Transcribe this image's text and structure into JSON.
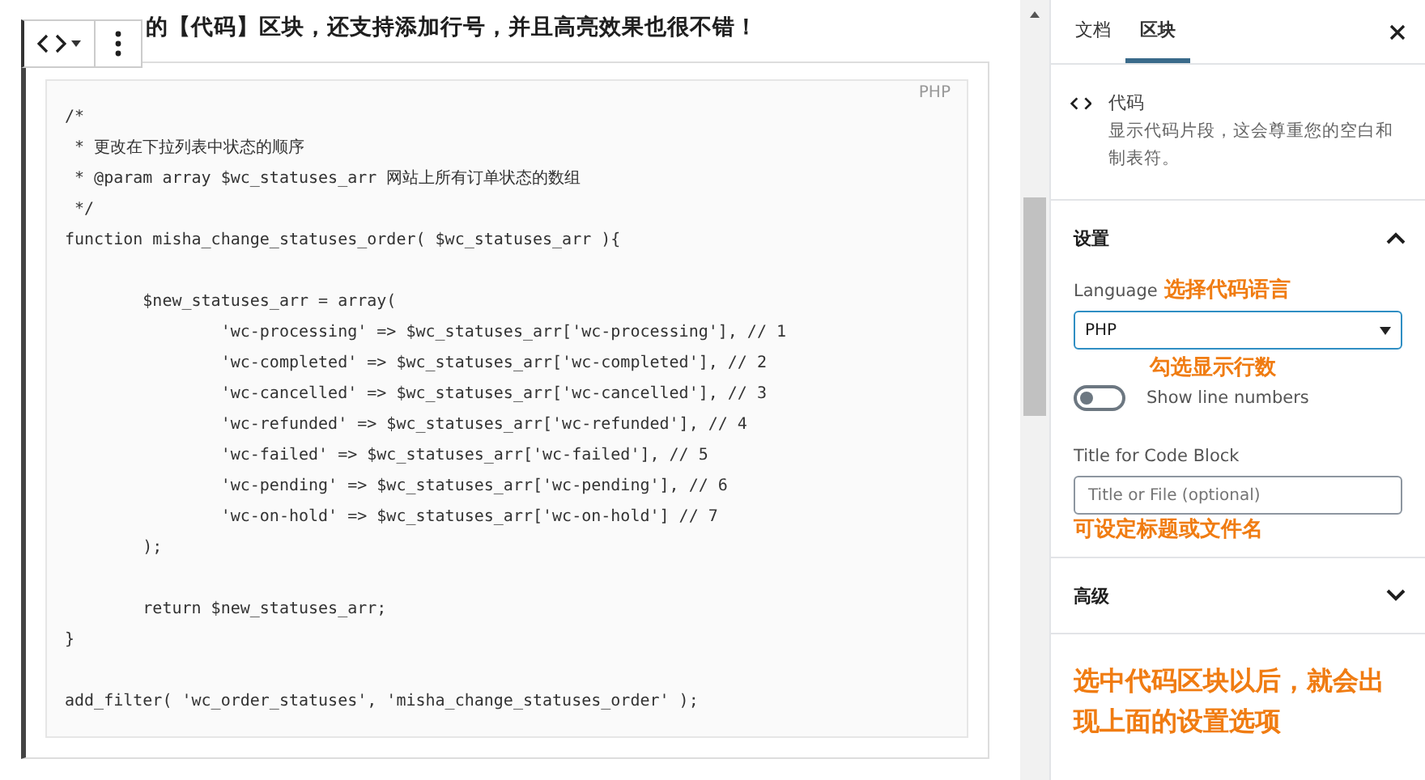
{
  "editor": {
    "intro_text": "的【代码】区块，还支持添加行号，并且高亮效果也很不错！",
    "code_block": {
      "language_badge": "PHP",
      "sections": [
        {
          "lines": [
            "/*",
            " * 更改在下拉列表中状态的顺序",
            " * @param array $wc_statuses_arr 网站上所有订单状态的数组",
            " */",
            "function misha_change_statuses_order( $wc_statuses_arr ){"
          ]
        },
        {
          "lines": [
            "        $new_statuses_arr = array(",
            "                'wc-processing' => $wc_statuses_arr['wc-processing'], // 1",
            "                'wc-completed' => $wc_statuses_arr['wc-completed'], // 2",
            "                'wc-cancelled' => $wc_statuses_arr['wc-cancelled'], // 3",
            "                'wc-refunded' => $wc_statuses_arr['wc-refunded'], // 4",
            "                'wc-failed' => $wc_statuses_arr['wc-failed'], // 5",
            "                'wc-pending' => $wc_statuses_arr['wc-pending'], // 6",
            "                'wc-on-hold' => $wc_statuses_arr['wc-on-hold'] // 7",
            "        );"
          ]
        },
        {
          "lines": [
            "        return $new_statuses_arr;",
            "}"
          ]
        },
        {
          "lines": [
            "add_filter( 'wc_order_statuses', 'misha_change_statuses_order' );"
          ]
        }
      ]
    }
  },
  "sidebar": {
    "tabs": [
      {
        "label": "文档",
        "selected": false
      },
      {
        "label": "区块",
        "selected": true
      }
    ],
    "block_card": {
      "title": "代码",
      "description": "显示代码片段，这会尊重您的空白和制表符。"
    },
    "panels": [
      {
        "kind": "settings",
        "title": "设置",
        "expanded": true,
        "language_label": "Language",
        "language_note": "选择代码语言",
        "language_value": "PHP",
        "toggle_note": "勾选显示行数",
        "toggle_label": "Show line numbers",
        "toggle_on": false,
        "title_label": "Title for Code Block",
        "title_placeholder": "Title or File (optional)",
        "title_note": "可设定标题或文件名"
      },
      {
        "kind": "advanced",
        "title": "高级",
        "expanded": false
      }
    ],
    "footer_note": "选中代码区块以后，就会出现上面的设置选项"
  }
}
